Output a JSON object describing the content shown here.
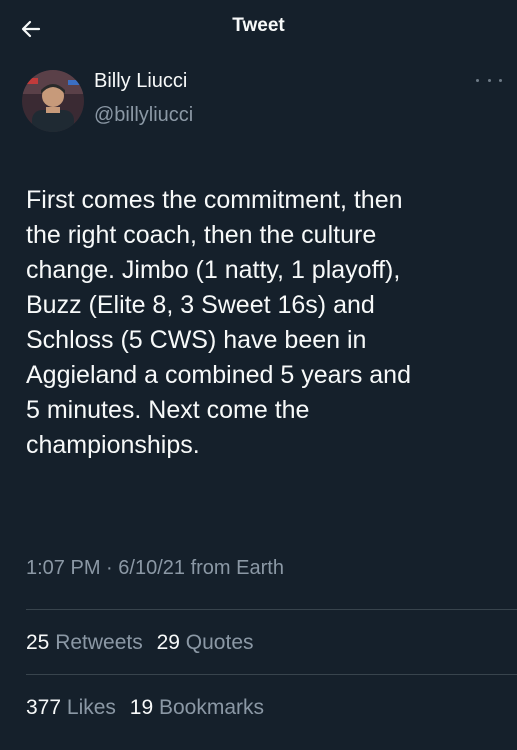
{
  "header": {
    "title": "Tweet",
    "back_icon": "arrow-left-icon"
  },
  "author": {
    "name": "Billy Liucci",
    "handle": "@billyliucci",
    "more_icon": "more-horizontal-icon"
  },
  "tweet": {
    "text": "First comes the commitment, then\nthe right coach, then the culture\nchange. Jimbo (1 natty, 1 playoff),\nBuzz (Elite 8, 3 Sweet 16s) and\nSchloss (5 CWS) have been in\nAggieland a combined 5 years and\n5 minutes. Next come the\nchampionships.",
    "time": "1:07 PM",
    "separator": "·",
    "date": "6/10/21",
    "source": "from Earth"
  },
  "stats": {
    "retweets_count": "25",
    "retweets_label": "Retweets",
    "quotes_count": "29",
    "quotes_label": "Quotes",
    "likes_count": "377",
    "likes_label": "Likes",
    "bookmarks_count": "19",
    "bookmarks_label": "Bookmarks"
  },
  "colors": {
    "background": "#15202b",
    "text": "#f7f9f9",
    "secondary": "#8b98a5",
    "divider": "#38444d"
  }
}
